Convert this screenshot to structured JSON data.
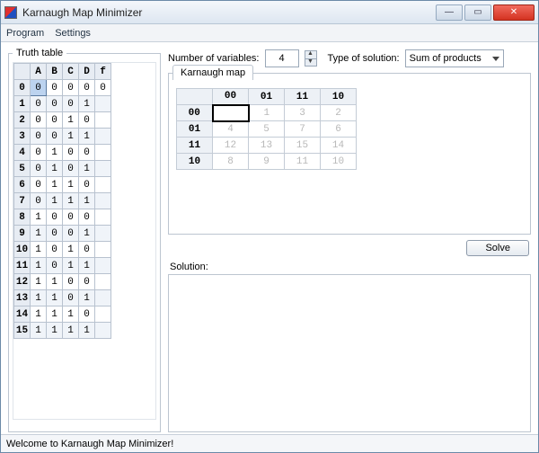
{
  "window": {
    "title": "Karnaugh Map Minimizer"
  },
  "menu": {
    "program": "Program",
    "settings": "Settings"
  },
  "truth": {
    "legend": "Truth table",
    "headers": [
      "",
      "A",
      "B",
      "C",
      "D",
      "f"
    ],
    "rows": [
      {
        "i": "0",
        "A": "0",
        "B": "0",
        "C": "0",
        "D": "0",
        "f": "0"
      },
      {
        "i": "1",
        "A": "0",
        "B": "0",
        "C": "0",
        "D": "1",
        "f": ""
      },
      {
        "i": "2",
        "A": "0",
        "B": "0",
        "C": "1",
        "D": "0",
        "f": ""
      },
      {
        "i": "3",
        "A": "0",
        "B": "0",
        "C": "1",
        "D": "1",
        "f": ""
      },
      {
        "i": "4",
        "A": "0",
        "B": "1",
        "C": "0",
        "D": "0",
        "f": ""
      },
      {
        "i": "5",
        "A": "0",
        "B": "1",
        "C": "0",
        "D": "1",
        "f": ""
      },
      {
        "i": "6",
        "A": "0",
        "B": "1",
        "C": "1",
        "D": "0",
        "f": ""
      },
      {
        "i": "7",
        "A": "0",
        "B": "1",
        "C": "1",
        "D": "1",
        "f": ""
      },
      {
        "i": "8",
        "A": "1",
        "B": "0",
        "C": "0",
        "D": "0",
        "f": ""
      },
      {
        "i": "9",
        "A": "1",
        "B": "0",
        "C": "0",
        "D": "1",
        "f": ""
      },
      {
        "i": "10",
        "A": "1",
        "B": "0",
        "C": "1",
        "D": "0",
        "f": ""
      },
      {
        "i": "11",
        "A": "1",
        "B": "0",
        "C": "1",
        "D": "1",
        "f": ""
      },
      {
        "i": "12",
        "A": "1",
        "B": "1",
        "C": "0",
        "D": "0",
        "f": ""
      },
      {
        "i": "13",
        "A": "1",
        "B": "1",
        "C": "0",
        "D": "1",
        "f": ""
      },
      {
        "i": "14",
        "A": "1",
        "B": "1",
        "C": "1",
        "D": "0",
        "f": ""
      },
      {
        "i": "15",
        "A": "1",
        "B": "1",
        "C": "1",
        "D": "1",
        "f": ""
      }
    ]
  },
  "controls": {
    "numvar_label": "Number of variables:",
    "numvar_value": "4",
    "soltype_label": "Type of solution:",
    "soltype_value": "Sum of products"
  },
  "kmap": {
    "tab_label": "Karnaugh map",
    "col_headers": [
      "",
      "00",
      "01",
      "11",
      "10"
    ],
    "rows": [
      {
        "h": "00",
        "c": [
          "",
          "1",
          "3",
          "2"
        ]
      },
      {
        "h": "01",
        "c": [
          "4",
          "5",
          "7",
          "6"
        ]
      },
      {
        "h": "11",
        "c": [
          "12",
          "13",
          "15",
          "14"
        ]
      },
      {
        "h": "10",
        "c": [
          "8",
          "9",
          "11",
          "10"
        ]
      }
    ]
  },
  "solve": {
    "button": "Solve",
    "label": "Solution:"
  },
  "status": {
    "text": "Welcome to Karnaugh Map Minimizer!"
  }
}
